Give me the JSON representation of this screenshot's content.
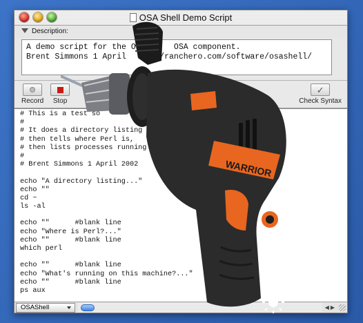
{
  "window": {
    "title": "OSA Shell Demo Script"
  },
  "description": {
    "label": "Description:",
    "lines": [
      "A demo script for the OS/      OSA component.",
      "Brent Simmons 1 April      //ranchero.com/software/osashell/"
    ]
  },
  "toolbar": {
    "record_label": "Record",
    "stop_label": "Stop",
    "check_label": "Check Syntax"
  },
  "script": {
    "lines": [
      "# This is a test so                      component.",
      "#",
      "# It does a directory listing",
      "# then tells where Perl is,",
      "# then lists processes running on t",
      "#",
      "# Brent Simmons 1 April 2002",
      "",
      "echo \"A directory listing...\"",
      "echo \"\"",
      "cd ~",
      "ls -al",
      "",
      "echo \"\"      #blank line",
      "echo \"Where is Perl?...\"",
      "echo \"\"      #blank line",
      "which perl",
      "",
      "echo \"\"      #blank line",
      "echo \"What's running on this machine?...\"",
      "echo \"\"      #blank line",
      "ps aux"
    ]
  },
  "statusbar": {
    "language": "OSAShell"
  },
  "overlay": {
    "brand": "WARRIOR"
  },
  "colors": {
    "desktop": "#2f63b6",
    "stop_red": "#c81b12",
    "drill_orange": "#e8661f",
    "drill_body": "#2b2b2b"
  }
}
